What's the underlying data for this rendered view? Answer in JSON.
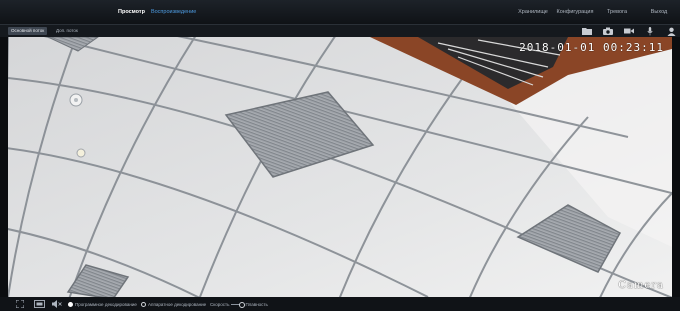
{
  "nav": {
    "left": [
      {
        "label": "Просмотр",
        "active": true
      },
      {
        "label": "Воспроизведение",
        "active": false
      }
    ],
    "right": [
      "Хранилище",
      "Конфигурация",
      "Тревога",
      "Выход"
    ]
  },
  "stream_tabs": {
    "main": "Основной поток",
    "sub": "Доп. поток"
  },
  "toolbar": {
    "icons": [
      "folder-icon",
      "camera-icon",
      "video-record-icon",
      "microphone-icon",
      "user-icon"
    ]
  },
  "video": {
    "timestamp": "2018-01-01 00:23:11",
    "camera_name": "Camera"
  },
  "bottom": {
    "software_decoding": "Программное декодирование",
    "hardware_decoding": "Аппаратное декодирование",
    "speed": "Скорость",
    "smoothness": "Плавность",
    "selected_decoding": "software"
  },
  "colors": {
    "accent_blue": "#4d9be0",
    "bar_bg": "#101317"
  }
}
